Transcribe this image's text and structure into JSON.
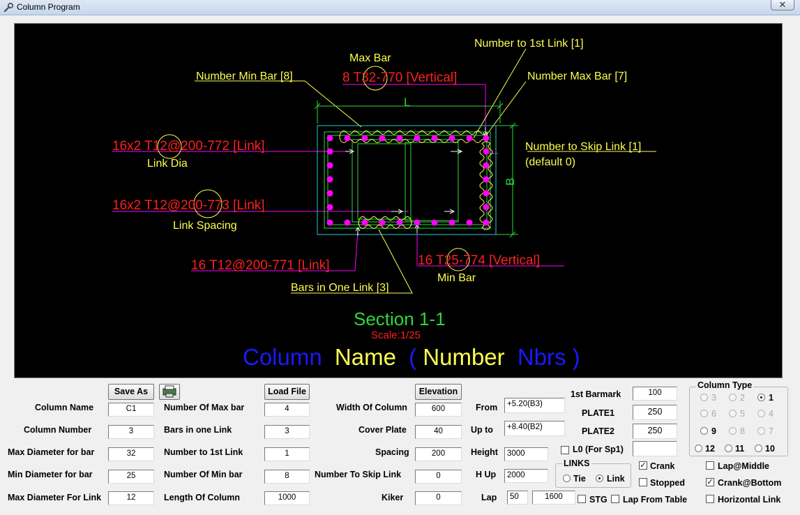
{
  "window": {
    "title": "Column Program",
    "close_glyph": "✕",
    "icon": "wrench-icon"
  },
  "drawing": {
    "colors": {
      "red": "#ff1f1f",
      "yellow": "#ffff4f",
      "green": "#2bd93b",
      "magenta": "#ff00ff",
      "cyan": "#20d0d0",
      "blue": "#1a1aff",
      "white": "#ffffff"
    },
    "max_bar_title": "Max Bar",
    "max_bar_callout": "8 T32-770 [Vertical]",
    "number_min_bar": "Number Min Bar [8]",
    "number_to_first_link": "Number to 1st Link [1]",
    "number_max_bar": "Number Max Bar [7]",
    "dim_L": "L",
    "dim_B": "B",
    "link_772": "16x2 T12@200-772 [Link]",
    "link_dia": "Link Dia",
    "number_to_skip_link": "Number to Skip Link [1]",
    "skip_default": "(default 0)",
    "link_773": "16x2 T12@200-773 [Link]",
    "link_spacing": "Link Spacing",
    "link_771": "16 T12@200-771 [Link]",
    "min_bar_callout": "16 T25-774 [Vertical]",
    "min_bar_title": "Min Bar",
    "bars_in_one_link": "Bars in One Link [3]",
    "section_title": "Section 1-1",
    "scale": "Scale:1/25",
    "name_parts": [
      "Column",
      "Name",
      "(",
      "Number",
      "Nbrs",
      ")"
    ]
  },
  "form": {
    "save_as": "Save As",
    "load_file": "Load File",
    "elevation": "Elevation",
    "column_name_label": "Column Name",
    "column_name": "C1",
    "column_number_label": "Column Number",
    "column_number": "3",
    "max_dia_bar_label": "Max Diameter for bar",
    "max_dia_bar": "32",
    "min_dia_bar_label": "Min Diameter for bar",
    "min_dia_bar": "25",
    "max_dia_link_label": "Max Diameter For Link",
    "max_dia_link": "12",
    "num_max_bar_label": "Number Of Max bar",
    "num_max_bar": "4",
    "bars_one_link_label": "Bars in one Link",
    "bars_one_link": "3",
    "num_first_link_label": "Number to 1st Link",
    "num_first_link": "1",
    "num_min_bar_label": "Number Of Min bar",
    "num_min_bar": "8",
    "length_col_label": "Length Of Column",
    "length_col": "1000",
    "width_col_label": "Width Of Column",
    "width_col": "600",
    "cover_plate_label": "Cover Plate",
    "cover_plate": "40",
    "spacing_label": "Spacing",
    "spacing": "200",
    "skip_link_label": "Number To Skip Link",
    "skip_link": "0",
    "kiker_label": "Kiker",
    "kiker": "0",
    "from_label": "From",
    "from": "+5.20(B3)",
    "upto_label": "Up to",
    "upto": "+8.40(B2)",
    "height_label": "Height",
    "height": "3000",
    "hup_label": "H Up",
    "hup": "2000",
    "lap_label": "Lap",
    "lap1": "50",
    "lap2": "1600",
    "first_barmark_label": "1st Barmark",
    "first_barmark": "100",
    "plate1_label": "PLATE1",
    "plate1": "250",
    "plate2_label": "PLATE2",
    "plate2": "250",
    "l0_label": "L0 (For Sp1)",
    "l0": "",
    "links_title": "LINKS",
    "tie_label": "Tie",
    "link_label": "Link",
    "stg_label": "STG",
    "crank_label": "Crank",
    "stopped_label": "Stopped",
    "lap_from_table_label": "Lap From Table",
    "lap_middle_label": "Lap@Middle",
    "crank_bottom_label": "Crank@Bottom",
    "horizontal_link_label": "Horizontal Link",
    "check_glyph": "✓",
    "column_type_title": "Column Type",
    "column_types": [
      "3",
      "2",
      "1",
      "6",
      "5",
      "4",
      "9",
      "8",
      "7",
      "12",
      "11",
      "10"
    ]
  }
}
